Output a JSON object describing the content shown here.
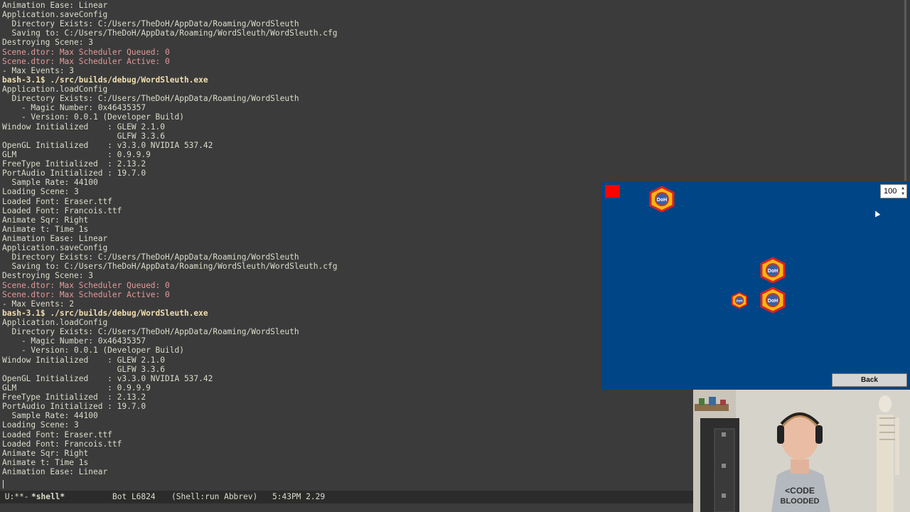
{
  "terminal": {
    "lines": [
      {
        "text": "Animation Ease: Linear",
        "style": "normal"
      },
      {
        "text": "Application.saveConfig",
        "style": "normal"
      },
      {
        "text": "  Directory Exists: C:/Users/TheDoH/AppData/Roaming/WordSleuth",
        "style": "normal"
      },
      {
        "text": "  Saving to: C:/Users/TheDoH/AppData/Roaming/WordSleuth/WordSleuth.cfg",
        "style": "normal"
      },
      {
        "text": "Destroying Scene: 3",
        "style": "normal"
      },
      {
        "text": "Scene.dtor: Max Scheduler Queued: 0",
        "style": "pink"
      },
      {
        "text": "Scene.dtor: Max Scheduler Active: 0",
        "style": "pink"
      },
      {
        "text": "- Max Events: 3",
        "style": "normal"
      },
      {
        "prompt": "bash-3.1$",
        "cmd": " ./src/builds/debug/WordSleuth.exe",
        "style": "prompt"
      },
      {
        "text": "Application.loadConfig",
        "style": "normal"
      },
      {
        "text": "  Directory Exists: C:/Users/TheDoH/AppData/Roaming/WordSleuth",
        "style": "normal"
      },
      {
        "text": "    - Magic Number: 0x46435357",
        "style": "normal"
      },
      {
        "text": "    - Version: 0.0.1 (Developer Build)",
        "style": "normal"
      },
      {
        "text": "Window Initialized    : GLEW 2.1.0",
        "style": "normal"
      },
      {
        "text": "                        GLFW 3.3.6",
        "style": "normal"
      },
      {
        "text": "OpenGL Initialized    : v3.3.0 NVIDIA 537.42",
        "style": "normal"
      },
      {
        "text": "GLM                   : 0.9.9.9",
        "style": "normal"
      },
      {
        "text": "FreeType Initialized  : 2.13.2",
        "style": "normal"
      },
      {
        "text": "PortAudio Initialized : 19.7.0",
        "style": "normal"
      },
      {
        "text": "  Sample Rate: 44100",
        "style": "normal"
      },
      {
        "text": "Loading Scene: 3",
        "style": "normal"
      },
      {
        "text": "Loaded Font: Eraser.ttf",
        "style": "normal"
      },
      {
        "text": "Loaded Font: Francois.ttf",
        "style": "normal"
      },
      {
        "text": "Animate Sqr: Right",
        "style": "normal"
      },
      {
        "text": "Animate t: Time 1s",
        "style": "normal"
      },
      {
        "text": "Animation Ease: Linear",
        "style": "normal"
      },
      {
        "text": "Application.saveConfig",
        "style": "normal"
      },
      {
        "text": "  Directory Exists: C:/Users/TheDoH/AppData/Roaming/WordSleuth",
        "style": "normal"
      },
      {
        "text": "  Saving to: C:/Users/TheDoH/AppData/Roaming/WordSleuth/WordSleuth.cfg",
        "style": "normal"
      },
      {
        "text": "Destroying Scene: 3",
        "style": "normal"
      },
      {
        "text": "Scene.dtor: Max Scheduler Queued: 0",
        "style": "pink"
      },
      {
        "text": "Scene.dtor: Max Scheduler Active: 0",
        "style": "pink"
      },
      {
        "text": "- Max Events: 2",
        "style": "normal"
      },
      {
        "prompt": "bash-3.1$",
        "cmd": " ./src/builds/debug/WordSleuth.exe",
        "style": "prompt"
      },
      {
        "text": "Application.loadConfig",
        "style": "normal"
      },
      {
        "text": "  Directory Exists: C:/Users/TheDoH/AppData/Roaming/WordSleuth",
        "style": "normal"
      },
      {
        "text": "    - Magic Number: 0x46435357",
        "style": "normal"
      },
      {
        "text": "    - Version: 0.0.1 (Developer Build)",
        "style": "normal"
      },
      {
        "text": "Window Initialized    : GLEW 2.1.0",
        "style": "normal"
      },
      {
        "text": "                        GLFW 3.3.6",
        "style": "normal"
      },
      {
        "text": "OpenGL Initialized    : v3.3.0 NVIDIA 537.42",
        "style": "normal"
      },
      {
        "text": "GLM                   : 0.9.9.9",
        "style": "normal"
      },
      {
        "text": "FreeType Initialized  : 2.13.2",
        "style": "normal"
      },
      {
        "text": "PortAudio Initialized : 19.7.0",
        "style": "normal"
      },
      {
        "text": "  Sample Rate: 44100",
        "style": "normal"
      },
      {
        "text": "Loading Scene: 3",
        "style": "normal"
      },
      {
        "text": "Loaded Font: Eraser.ttf",
        "style": "normal"
      },
      {
        "text": "Loaded Font: Francois.ttf",
        "style": "normal"
      },
      {
        "text": "Animate Sqr: Right",
        "style": "normal"
      },
      {
        "text": "Animate t: Time 1s",
        "style": "normal"
      },
      {
        "text": "Animation Ease: Linear",
        "style": "normal"
      }
    ]
  },
  "modeline": {
    "status": " U:**-",
    "buffer": "*shell*",
    "position": "Bot L6824",
    "modes": "(Shell:run Abbrev)",
    "time_load": "5:43PM 2.29"
  },
  "game": {
    "spin_value": "100",
    "back_label": "Back",
    "logo_text": "DoH",
    "colors": {
      "background": "#004586",
      "square": "#ff0000"
    }
  },
  "webcam": {
    "shirt_text_1": "<CODE",
    "shirt_text_2": "BLOODED"
  },
  "icons": [
    "logo-icon",
    "spin-arrows-icon",
    "mouse-pointer-icon"
  ]
}
